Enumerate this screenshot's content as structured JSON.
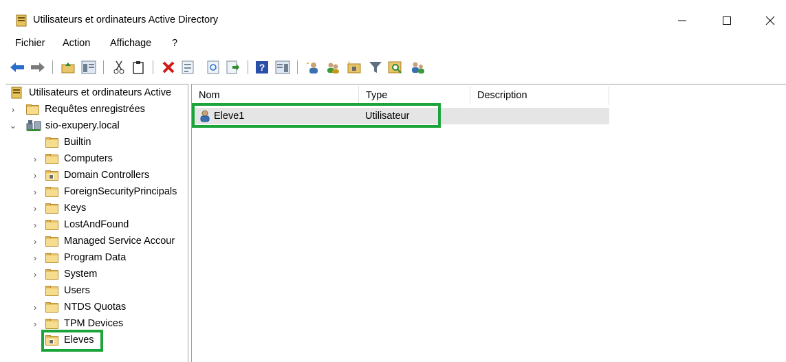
{
  "window": {
    "title": "Utilisateurs et ordinateurs Active Directory",
    "minimize_glyph": "—",
    "maximize_glyph": "☐",
    "close_glyph": "✕"
  },
  "menu": [
    "Fichier",
    "Action",
    "Affichage",
    "?"
  ],
  "toolbar": {
    "icons": [
      "back-icon",
      "forward-icon",
      "up-folder-icon",
      "show-hide-console-tree-icon",
      "cut-icon",
      "copy-icon",
      "delete-icon",
      "properties-icon",
      "refresh-icon",
      "export-list-icon",
      "help-icon",
      "show-action-pane-icon",
      "new-user-icon",
      "new-group-icon",
      "new-ou-icon",
      "filter-icon",
      "find-icon",
      "add-to-group-icon"
    ]
  },
  "tree": {
    "root": "Utilisateurs et ordinateurs Active",
    "saved_queries": "Requêtes enregistrées",
    "domain": "sio-exupery.local",
    "children": [
      "Builtin",
      "Computers",
      "Domain Controllers",
      "ForeignSecurityPrincipals",
      "Keys",
      "LostAndFound",
      "Managed Service Accour",
      "Program Data",
      "System",
      "Users",
      "NTDS Quotas",
      "TPM Devices",
      "Eleves"
    ],
    "selected": "Eleves"
  },
  "list": {
    "columns": [
      "Nom",
      "Type",
      "Description"
    ],
    "rows": [
      {
        "name": "Eleve1",
        "type": "Utilisateur",
        "description": ""
      }
    ]
  },
  "colors": {
    "highlight": "#1aa43a",
    "folder": "#e8c56a",
    "row_selected": "#e5e5e5"
  }
}
